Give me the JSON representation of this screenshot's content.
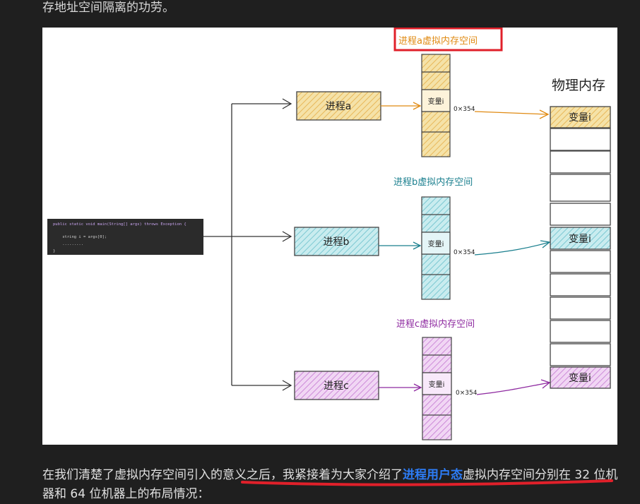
{
  "article": {
    "top_text": "存地址空间隔离的功劳。",
    "bottom_text_before": "在我们清楚了虚拟内存空间引入的意义之后，我紧接着为大家介绍了",
    "bottom_text_highlight": "进程用户态",
    "bottom_text_after": "虚拟内存空间分别在 32 位机器和 64 位机器上的布局情况："
  },
  "diagram": {
    "code_lines": [
      "public static void main(String[] args) throws Exception {",
      "    string i = args[0];",
      "    .........",
      "}"
    ],
    "processes": [
      {
        "label": "进程a",
        "vm_title": "进程a虚拟内存空间",
        "var": "变量i",
        "addr": "0×354",
        "color": "#f2d68a",
        "stroke": "#e08a12",
        "title_color": "#e08a12"
      },
      {
        "label": "进程b",
        "vm_title": "进程b虚拟内存空间",
        "var": "变量i",
        "addr": "0×354",
        "color": "#9fd9e0",
        "stroke": "#1a7f8e",
        "title_color": "#1a7f8e"
      },
      {
        "label": "进程c",
        "vm_title": "进程c虚拟内存空间",
        "var": "变量i",
        "addr": "0×354",
        "color": "#e3b3ea",
        "stroke": "#8e2aa0",
        "title_color": "#8e2aa0"
      }
    ],
    "physical_title": "物理内存",
    "physical_var": "变量i"
  }
}
